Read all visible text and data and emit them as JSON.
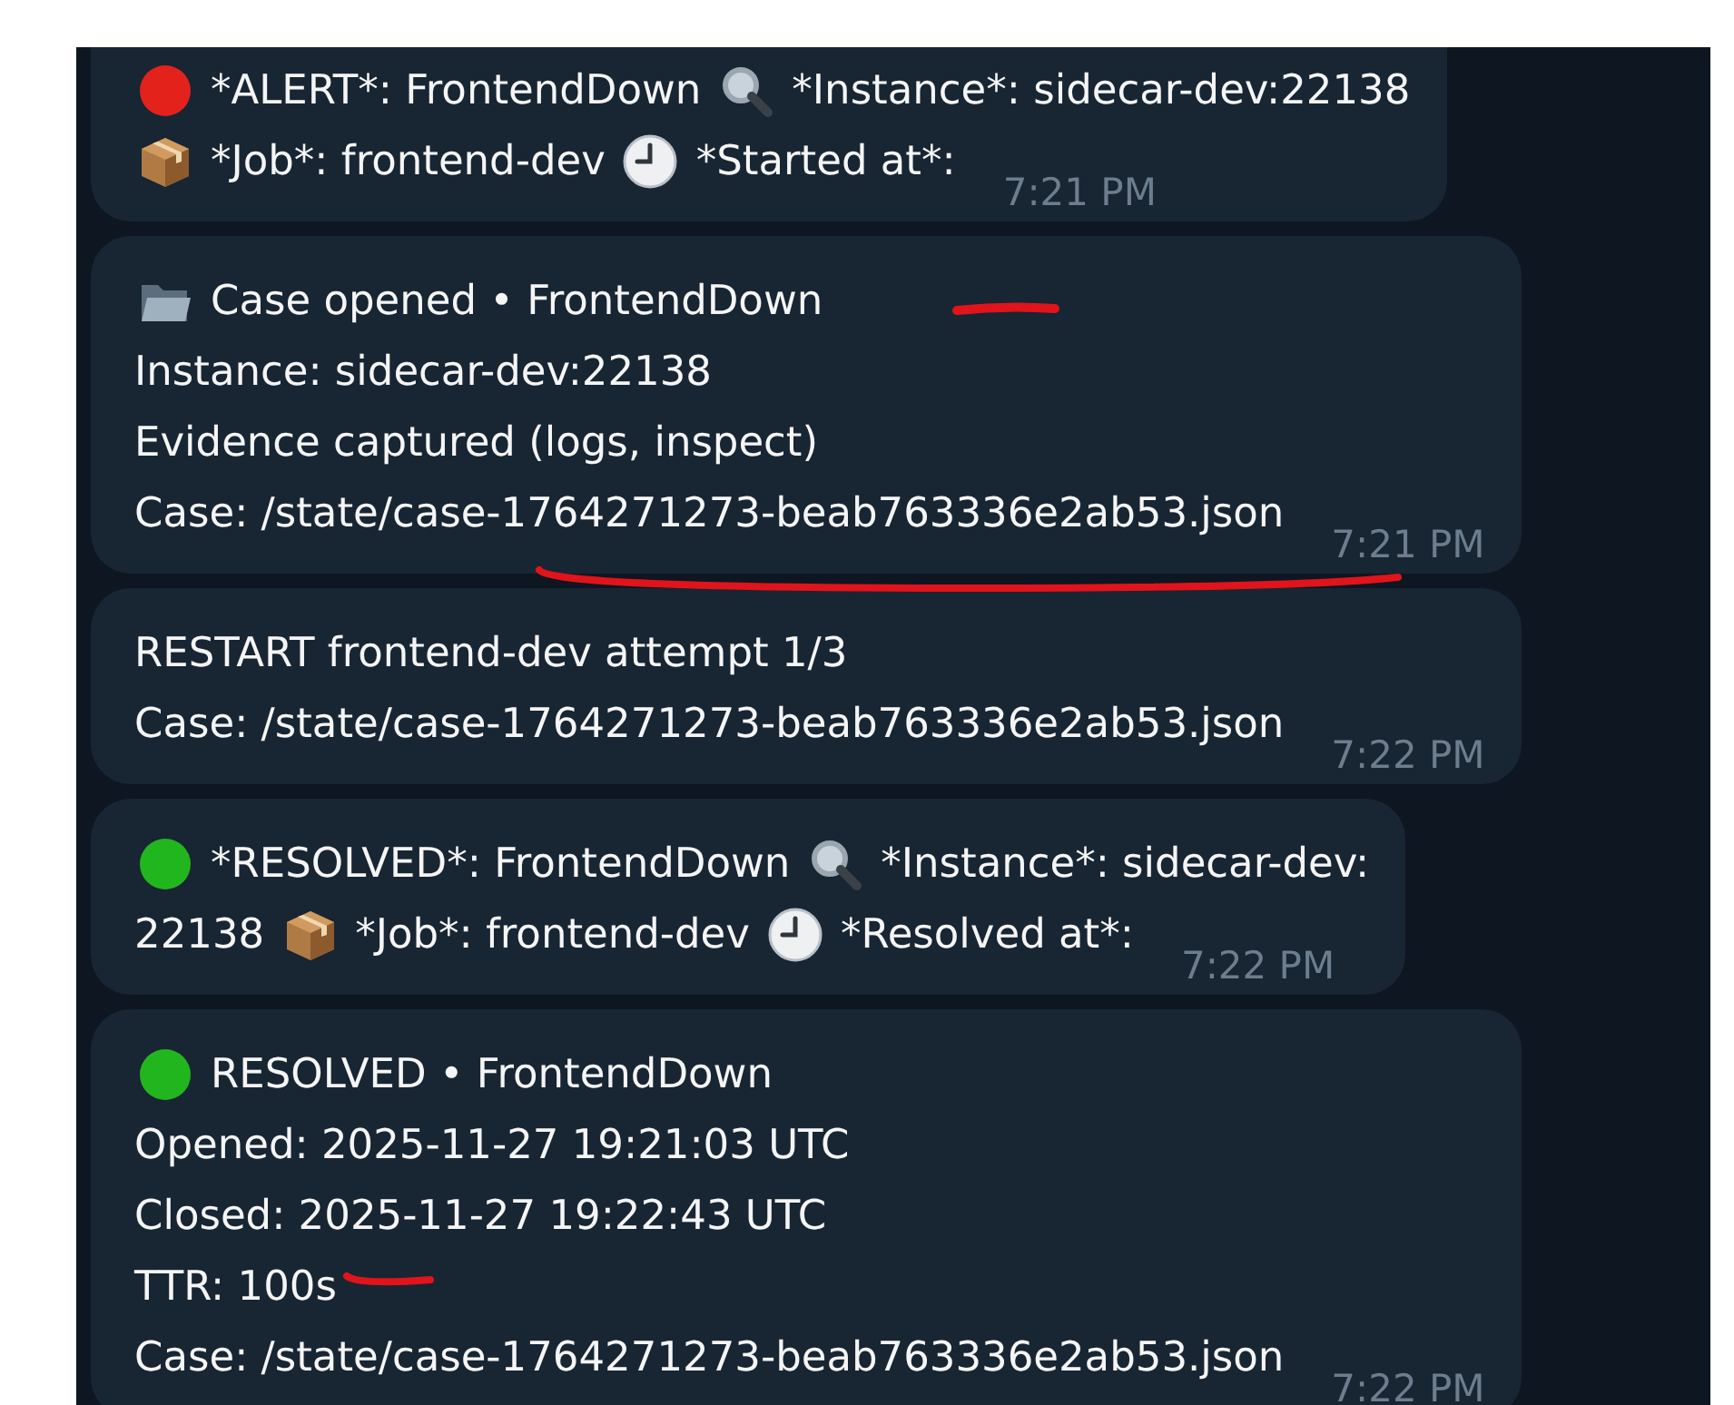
{
  "messages": [
    {
      "lines": [
        [
          {
            "kind": "dot",
            "color": "#e3221c"
          },
          {
            "kind": "text",
            "text": "*ALERT*: FrontendDown"
          },
          {
            "kind": "search"
          },
          {
            "kind": "text",
            "text": "*Instance*: sidecar-dev:22138"
          }
        ],
        [
          {
            "kind": "package"
          },
          {
            "kind": "text",
            "text": "*Job*: frontend-dev"
          },
          {
            "kind": "clock"
          },
          {
            "kind": "text",
            "text": "*Started at*:"
          }
        ]
      ],
      "time": "7:21 PM",
      "top": true
    },
    {
      "lines": [
        [
          {
            "kind": "folder"
          },
          {
            "kind": "text",
            "text": "Case opened • FrontendDown"
          }
        ],
        [
          {
            "kind": "text",
            "text": "Instance: sidecar-dev:22138"
          }
        ],
        [
          {
            "kind": "text",
            "text": "Evidence captured (logs, inspect)"
          }
        ],
        [
          {
            "kind": "text",
            "text": "Case: /state/case-1764271273-beab763336e2ab53.json"
          }
        ]
      ],
      "time": "7:21 PM",
      "top": false
    },
    {
      "lines": [
        [
          {
            "kind": "text",
            "text": "RESTART frontend-dev attempt 1/3"
          }
        ],
        [
          {
            "kind": "text",
            "text": "Case: /state/case-1764271273-beab763336e2ab53.json"
          }
        ]
      ],
      "time": "7:22 PM",
      "top": false
    },
    {
      "lines": [
        [
          {
            "kind": "dot",
            "color": "#22b61e"
          },
          {
            "kind": "text",
            "text": "*RESOLVED*: FrontendDown"
          },
          {
            "kind": "search"
          },
          {
            "kind": "text",
            "text": "*Instance*: sidecar-dev:"
          }
        ],
        [
          {
            "kind": "text",
            "text": "22138"
          },
          {
            "kind": "package"
          },
          {
            "kind": "text",
            "text": "*Job*: frontend-dev"
          },
          {
            "kind": "clock"
          },
          {
            "kind": "text",
            "text": "*Resolved at*:"
          }
        ]
      ],
      "time": "7:22 PM",
      "top": false
    },
    {
      "lines": [
        [
          {
            "kind": "dot",
            "color": "#22b61e"
          },
          {
            "kind": "text",
            "text": "RESOLVED • FrontendDown"
          }
        ],
        [
          {
            "kind": "text",
            "text": "Opened: 2025-11-27 19:21:03 UTC"
          }
        ],
        [
          {
            "kind": "text",
            "text": "Closed: 2025-11-27 19:22:43 UTC"
          }
        ],
        [
          {
            "kind": "text",
            "text": "TTR: 100s"
          }
        ],
        [
          {
            "kind": "text",
            "text": "Case: /state/case-1764271273-beab763336e2ab53.json"
          }
        ]
      ],
      "time": "7:22 PM",
      "top": false
    }
  ]
}
